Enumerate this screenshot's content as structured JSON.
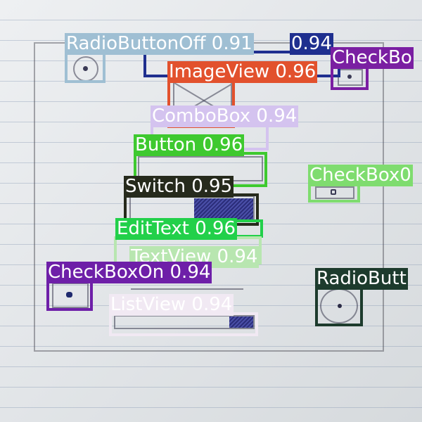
{
  "detections": [
    {
      "id": "radiobuttonoff",
      "label": "RadioButtonOff 0.91",
      "color": "#9fbfd3",
      "text_color": "#ffffff"
    },
    {
      "id": "navy",
      "label": "0.94",
      "color": "#1f2f8f",
      "text_color": "#ffffff"
    },
    {
      "id": "imageview",
      "label": "ImageView 0.96",
      "color": "#e2512d",
      "text_color": "#ffffff"
    },
    {
      "id": "checkbox-top-right",
      "label": "CheckBo",
      "color": "#7a1fa2",
      "text_color": "#ffffff"
    },
    {
      "id": "combobox",
      "label": "ComboBox 0.94",
      "color": "#d4c3ef",
      "text_color": "#ffffff"
    },
    {
      "id": "button",
      "label": "Button 0.96",
      "color": "#3ec92f",
      "text_color": "#ffffff"
    },
    {
      "id": "checkbox-right",
      "label": "CheckBox0",
      "color": "#7fdc6f",
      "text_color": "#ffffff"
    },
    {
      "id": "switch",
      "label": "Switch 0.95",
      "color": "#262a1c",
      "text_color": "#ffffff"
    },
    {
      "id": "edittext",
      "label": "EditText 0.96",
      "color": "#22d04a",
      "text_color": "#ffffff"
    },
    {
      "id": "textview",
      "label": "TextView 0.94",
      "color": "#b8e6b0",
      "text_color": "#ffffff"
    },
    {
      "id": "checkboxon",
      "label": "CheckBoxOn 0.94",
      "color": "#6e1fa8",
      "text_color": "#ffffff"
    },
    {
      "id": "radiobutton-right",
      "label": "RadioButt",
      "color": "#1d3b2d",
      "text_color": "#ffffff"
    },
    {
      "id": "listview",
      "label": "ListView 0.94",
      "color": "#f1e9f3",
      "text_color": "#ffffff"
    }
  ]
}
